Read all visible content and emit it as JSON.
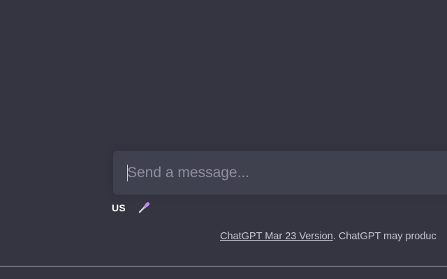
{
  "composer": {
    "placeholder": "Send a message...",
    "value": ""
  },
  "tools": {
    "language": "US",
    "mic_icon": "microphone-icon",
    "mic_color": "#c084fc"
  },
  "footer": {
    "version_link": "ChatGPT Mar 23 Version",
    "disclaimer": ". ChatGPT may produc"
  },
  "colors": {
    "background": "#343541",
    "input_background": "#40414f",
    "placeholder": "#8e8ea0"
  }
}
